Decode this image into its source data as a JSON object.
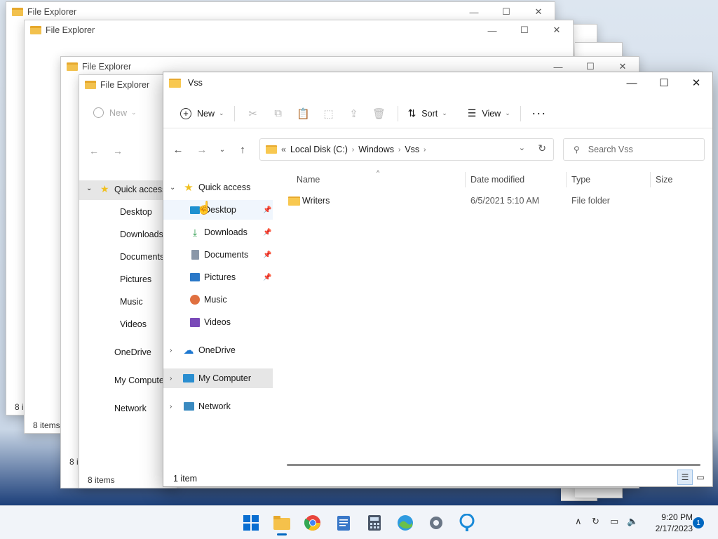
{
  "background_windows": [
    {
      "title": "File Explorer",
      "status": "8 i"
    },
    {
      "title": "File Explorer",
      "status": "8 items"
    },
    {
      "title": "File Explorer",
      "status": "8 i"
    },
    {
      "title": "File Explorer",
      "status": "8 items"
    }
  ],
  "background_nav_front": {
    "new_label": "New",
    "items": [
      "Quick access",
      "Desktop",
      "Downloads",
      "Documents",
      "Pictures",
      "Music",
      "Videos",
      "OneDrive",
      "My Compute",
      "Network"
    ]
  },
  "window": {
    "title": "Vss",
    "controls": {
      "minimize": "—",
      "maximize": "☐",
      "close": "✕"
    }
  },
  "toolbar": {
    "new_label": "New",
    "sort_label": "Sort",
    "view_label": "View",
    "more_label": "···"
  },
  "address": {
    "prefix": "«",
    "crumbs": [
      "Local Disk (C:)",
      "Windows",
      "Vss"
    ]
  },
  "search": {
    "placeholder": "Search Vss"
  },
  "nav": {
    "quick_access": "Quick access",
    "items": [
      {
        "label": "Desktop",
        "icon": "desktop-icon",
        "pinned": true
      },
      {
        "label": "Downloads",
        "icon": "downloads-icon",
        "pinned": true
      },
      {
        "label": "Documents",
        "icon": "documents-icon",
        "pinned": true
      },
      {
        "label": "Pictures",
        "icon": "pictures-icon",
        "pinned": true
      },
      {
        "label": "Music",
        "icon": "music-icon",
        "pinned": false
      },
      {
        "label": "Videos",
        "icon": "videos-icon",
        "pinned": false
      }
    ],
    "onedrive": "OneDrive",
    "my_computer": "My Computer",
    "network": "Network"
  },
  "columns": {
    "name": "Name",
    "date": "Date modified",
    "type": "Type",
    "size": "Size"
  },
  "files": [
    {
      "name": "Writers",
      "date": "6/5/2021 5:10 AM",
      "type": "File folder",
      "size": ""
    }
  ],
  "status": {
    "count": "1 item"
  },
  "taskbar": {
    "apps": [
      "start-icon",
      "file-explorer-icon",
      "chrome-icon",
      "notepad-icon",
      "calculator-icon",
      "photos-icon",
      "settings-icon",
      "cortana-icon"
    ],
    "time": "9:20 PM",
    "date": "2/17/2023",
    "notifications": "1"
  },
  "colors": {
    "accent": "#0067c0",
    "folder": "#f8c850",
    "selected": "#e6e6e6"
  }
}
